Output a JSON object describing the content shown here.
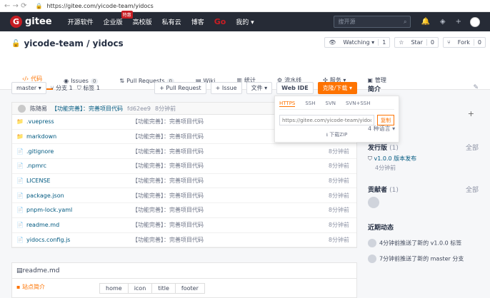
{
  "browser": {
    "url": "https://gitee.com/yicode-team/yidocs"
  },
  "nav": {
    "logo": "gitee",
    "items": [
      "开源软件",
      "企业版",
      "高校版",
      "私有云",
      "博客"
    ],
    "badge": "特惠",
    "go": "Go",
    "mine": "我的 ▾",
    "search_placeholder": "搜开源"
  },
  "repo": {
    "title": "yicode-team / yidocs",
    "watching": "Watching ▾",
    "watching_count": "1",
    "star": "Star",
    "star_count": "0",
    "fork": "Fork",
    "fork_count": "0"
  },
  "tabs": [
    {
      "label": "代码"
    },
    {
      "label": "Issues",
      "count": "0"
    },
    {
      "label": "Pull Requests",
      "count": "0"
    },
    {
      "label": "Wiki"
    },
    {
      "label": "统计"
    },
    {
      "label": "流水线"
    },
    {
      "label": "服务 ▾"
    },
    {
      "label": "管理"
    }
  ],
  "toolbar": {
    "branch": "master ▾",
    "branch_count": "分支 1",
    "tag_count": "标签 1",
    "pull_request": "+ Pull Request",
    "issue": "+ Issue",
    "file": "文件 ▾",
    "webide": "Web IDE",
    "clone": "克隆/下载 ▾"
  },
  "commit": {
    "author": "陈随易",
    "message": "【功能完善】：完善项目代码",
    "sha": "fd62ee9",
    "time": "8分钟前"
  },
  "files": [
    {
      "icon": "📁",
      "name": ".vuepress",
      "msg": "【功能完善】：完善项目代码",
      "time": "8分钟前"
    },
    {
      "icon": "📁",
      "name": "markdown",
      "msg": "【功能完善】：完善项目代码",
      "time": "8分钟前"
    },
    {
      "icon": "📄",
      "name": ".gitignore",
      "msg": "【功能完善】：完善项目代码",
      "time": "8分钟前"
    },
    {
      "icon": "📄",
      "name": ".npmrc",
      "msg": "【功能完善】：完善项目代码",
      "time": "8分钟前"
    },
    {
      "icon": "📄",
      "name": "LICENSE",
      "msg": "【功能完善】：完善项目代码",
      "time": "8分钟前"
    },
    {
      "icon": "📄",
      "name": "package.json",
      "msg": "【功能完善】：完善项目代码",
      "time": "8分钟前"
    },
    {
      "icon": "📄",
      "name": "pnpm-lock.yaml",
      "msg": "【功能完善】：完善项目代码",
      "time": "8分钟前"
    },
    {
      "icon": "📄",
      "name": "readme.md",
      "msg": "【功能完善】：完善项目代码",
      "time": "8分钟前"
    },
    {
      "icon": "📄",
      "name": "yidocs.config.js",
      "msg": "【功能完善】：完善项目代码",
      "time": "8分钟前"
    }
  ],
  "readme": {
    "title": "readme.md",
    "toc_first": "站点简介",
    "table_headers": [
      "home",
      "icon",
      "title",
      "footer"
    ]
  },
  "clone_dropdown": {
    "tabs": [
      "HTTPS",
      "SSH",
      "SVN",
      "SVN+SSH"
    ],
    "url": "https://gitee.com/yicode-team/yidocs.",
    "copy": "复制",
    "zip": "下载ZIP"
  },
  "sidebar": {
    "intro_title": "简介",
    "lang_text": "4 种语言 ▾",
    "release_title": "发行版",
    "release_count": "(1)",
    "all_label": "全部",
    "release_link": "v1.0.0 版本发布",
    "release_time": "4分钟前",
    "contrib_title": "贡献者",
    "contrib_count": "(1)",
    "activity_title": "近期动态",
    "activity": [
      {
        "text": "4分钟前推送了新的 v1.0.0 标签"
      },
      {
        "text": "7分钟前推送了新的 master 分支"
      }
    ]
  }
}
